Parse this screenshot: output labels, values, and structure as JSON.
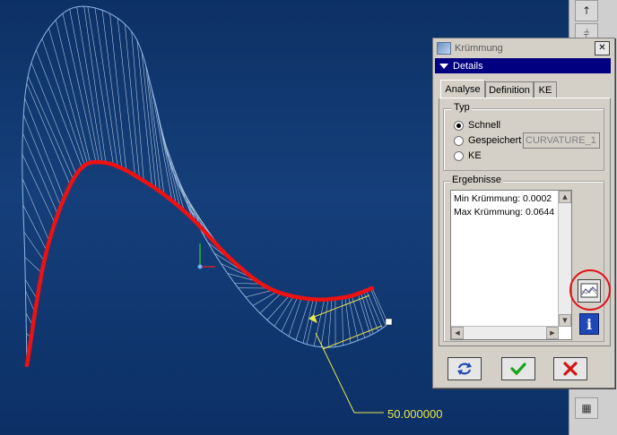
{
  "dialog": {
    "title": "Krümmung",
    "details_label": "Details",
    "tabs": [
      {
        "label": "Analyse",
        "active": true
      },
      {
        "label": "Definition",
        "active": false
      },
      {
        "label": "KE",
        "active": false
      }
    ],
    "type_group": {
      "title": "Typ",
      "options": [
        {
          "label": "Schnell",
          "selected": true
        },
        {
          "label": "Gespeichert",
          "selected": false
        },
        {
          "label": "KE",
          "selected": false
        }
      ],
      "saved_name_value": "CURVATURE_1"
    },
    "results_group": {
      "title": "Ergebnisse",
      "lines": [
        "Min Krümmung: 0.0002",
        "Max Krümmung: 0.0644"
      ]
    },
    "icons": {
      "graph": "curvature-graph-icon",
      "info": "info-icon",
      "repeat": "repeat-icon",
      "ok": "checkmark-icon",
      "cancel": "cancel-x-icon"
    },
    "info_glyph": "i"
  },
  "viewport": {
    "dimension_value": "50.000000"
  },
  "toolbar": {
    "icons": [
      "arrow-icon",
      "datum-icon",
      "table-icon"
    ]
  },
  "colors": {
    "viewport_background": "#123a72",
    "curve": "#ee1111",
    "comb": "#c8dcf0",
    "dimension": "#e8e84a",
    "highlight": "#e0141a",
    "title_bar": "#000080"
  }
}
